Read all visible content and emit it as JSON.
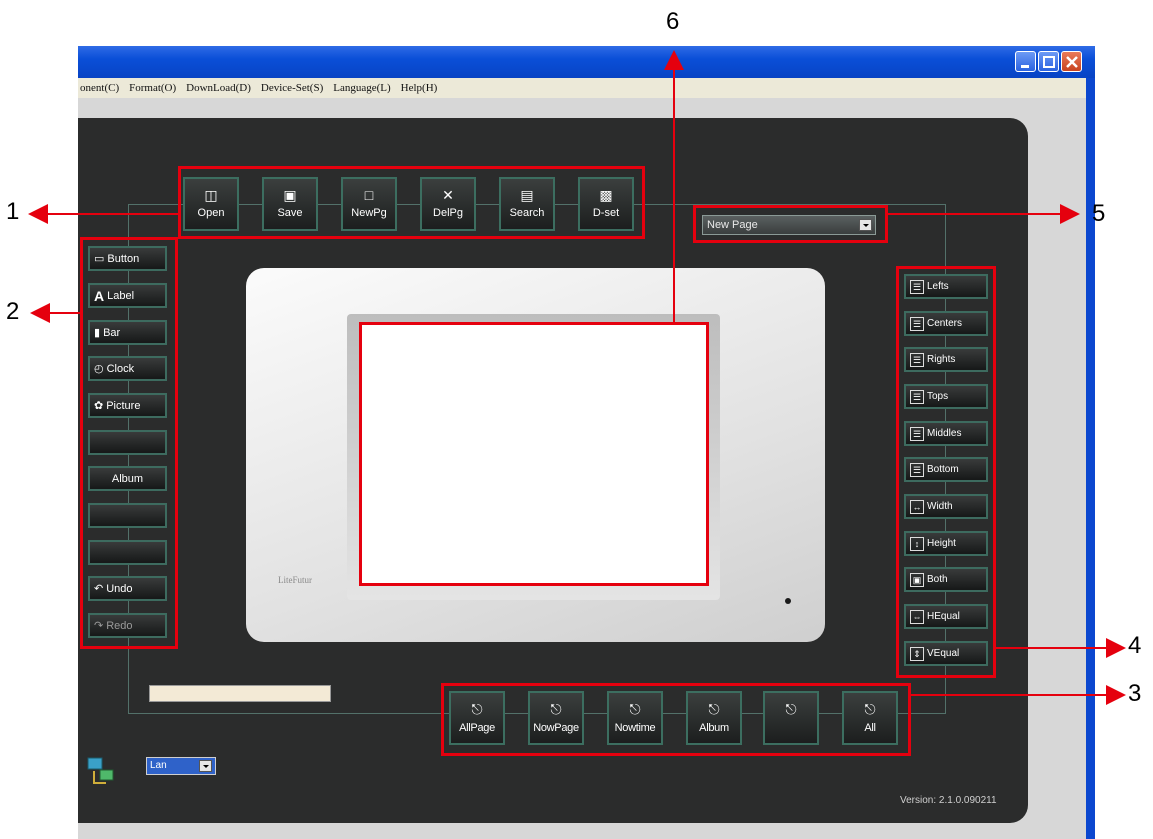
{
  "menu": [
    "onent(C)",
    "Format(O)",
    "DownLoad(D)",
    "Device-Set(S)",
    "Language(L)",
    "Help(H)"
  ],
  "toolbar": [
    {
      "label": "Open",
      "icon": "open-icon"
    },
    {
      "label": "Save",
      "icon": "save-icon"
    },
    {
      "label": "NewPg",
      "icon": "new-page-icon"
    },
    {
      "label": "DelPg",
      "icon": "delete-icon"
    },
    {
      "label": "Search",
      "icon": "search-icon"
    },
    {
      "label": "D-set",
      "icon": "device-set-icon"
    }
  ],
  "components": [
    {
      "label": "Button",
      "icon": "button-icon"
    },
    {
      "label": "Label",
      "icon": "label-icon"
    },
    {
      "label": "Bar",
      "icon": "bar-icon"
    },
    {
      "label": "Clock",
      "icon": "clock-icon"
    },
    {
      "label": "Picture",
      "icon": "picture-icon"
    },
    {
      "label": ""
    },
    {
      "label": "Album"
    },
    {
      "label": ""
    },
    {
      "label": ""
    },
    {
      "label": "Undo",
      "icon": "undo-icon"
    },
    {
      "label": "Redo",
      "icon": "redo-icon"
    }
  ],
  "align": [
    {
      "label": "Lefts",
      "icon": "align-left-icon"
    },
    {
      "label": "Centers",
      "icon": "align-center-icon"
    },
    {
      "label": "Rights",
      "icon": "align-right-icon"
    },
    {
      "label": "Tops",
      "icon": "align-top-icon"
    },
    {
      "label": "Middles",
      "icon": "align-middle-icon"
    },
    {
      "label": "Bottom",
      "icon": "align-bottom-icon"
    },
    {
      "label": "Width",
      "icon": "same-width-icon"
    },
    {
      "label": "Height",
      "icon": "same-height-icon"
    },
    {
      "label": "Both",
      "icon": "same-size-icon"
    },
    {
      "label": "HEqual",
      "icon": "h-equal-icon"
    },
    {
      "label": "VEqual",
      "icon": "v-equal-icon"
    }
  ],
  "download": [
    {
      "label": "AllPage",
      "icon": "download-icon"
    },
    {
      "label": "NowPage",
      "icon": "download-icon"
    },
    {
      "label": "Nowtime",
      "icon": "download-icon"
    },
    {
      "label": "Album",
      "icon": "download-icon"
    },
    {
      "label": "",
      "icon": "download-icon"
    },
    {
      "label": "All",
      "icon": "download-icon"
    }
  ],
  "page_select": {
    "value": "New Page"
  },
  "connection_select": {
    "value": "Lan"
  },
  "device_brand": "LiteFutur",
  "version": "Version: 2.1.0.090211",
  "callouts": [
    "1",
    "2",
    "3",
    "4",
    "5",
    "6"
  ],
  "colors": {
    "highlight": "#e5000e",
    "panel": "#2b2c2c",
    "title_bar": "#0a4fd8"
  }
}
